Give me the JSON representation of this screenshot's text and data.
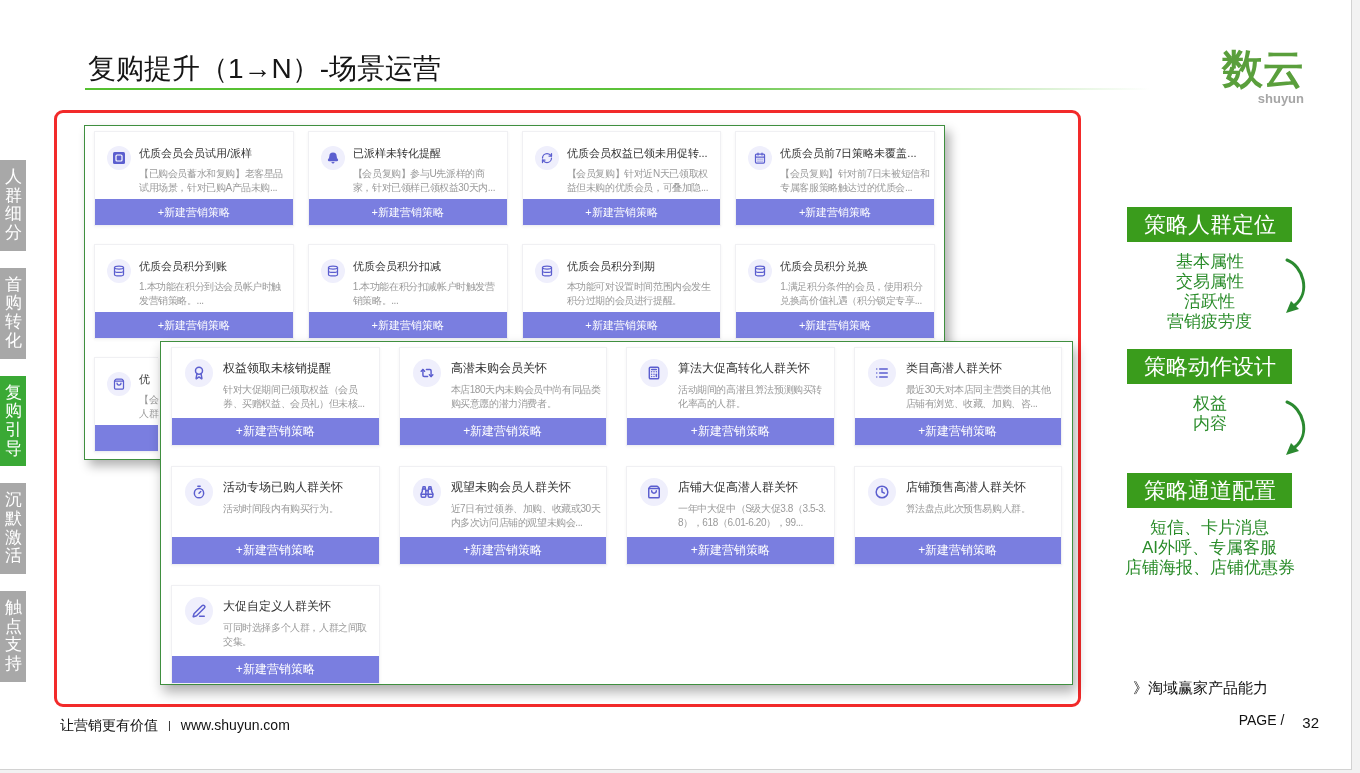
{
  "slide": {
    "title": "复购提升（1→N）-场景运营",
    "logo_mark": "数云",
    "logo_wordmark": "shuyun"
  },
  "side_sections": [
    {
      "label": "人群细分",
      "selected": false
    },
    {
      "label": "首购转化",
      "selected": false
    },
    {
      "label": "复购引导",
      "selected": true
    },
    {
      "label": "沉默激活",
      "selected": false
    },
    {
      "label": "触点支持",
      "selected": false
    }
  ],
  "back_panel": {
    "cards": [
      {
        "kind": "full",
        "title": "优质会员会员试用/派样",
        "description": "【已购会员蓄水和复购】老客星品试用场景，针对已购A产品未购...",
        "action": "+新建营销策略"
      },
      {
        "kind": "full",
        "title": "已派样未转化提醒",
        "description": "【会员复购】参与U先派样的商家，针对已领样已领权益30天内...",
        "action": "+新建营销策略"
      },
      {
        "kind": "full",
        "title": "优质会员权益已领未用促转...",
        "description": "【会员复购】针对近N天已领取权益但未购的优质会员，可叠加隐...",
        "action": "+新建营销策略"
      },
      {
        "kind": "full",
        "title": "优质会员前7日策略未覆盖...",
        "description": "【会员复购】针对前7日未被短信和专属客服策略触达过的优质会...",
        "action": "+新建营销策略"
      },
      {
        "kind": "full",
        "title": "优质会员积分到账",
        "description": "1.本功能在积分到达会员帐户时触发营销策略。...",
        "action": "+新建营销策略"
      },
      {
        "kind": "full",
        "title": "优质会员积分扣减",
        "description": "1.本功能在积分扣减帐户时触发营销策略。...",
        "action": "+新建营销策略"
      },
      {
        "kind": "full",
        "title": "优质会员积分到期",
        "description": "本功能可对设置时间范围内会发生积分过期的会员进行提醒。",
        "action": "+新建营销策略"
      },
      {
        "kind": "full",
        "title": "优质会员积分兑换",
        "description": "1.满足积分条件的会员，使用积分兑换高价值礼遇（积分锁定专享...",
        "action": "+新建营销策略"
      },
      {
        "kind": "covered",
        "title": "优",
        "description": "【会人群"
      }
    ]
  },
  "front_panel": {
    "cards": [
      {
        "title": "权益领取未核销提醒",
        "description": "针对大促期间已领取权益（会员券、买赠权益、会员礼）但未核...",
        "action": "+新建营销策略"
      },
      {
        "title": "高潜未购会员关怀",
        "description": "本店180天内未购会员中尚有同品类购买意愿的潜力消费者。",
        "action": "+新建营销策略"
      },
      {
        "title": "算法大促高转化人群关怀",
        "description": "活动期间的高潜且算法预测购买转化率高的人群。",
        "action": "+新建营销策略"
      },
      {
        "title": "类目高潜人群关怀",
        "description": "最近30天对本店同主营类目的其他店铺有浏览、收藏、加购、咨...",
        "action": "+新建营销策略"
      },
      {
        "title": "活动专场已购人群关怀",
        "description": "活动时间段内有购买行为。",
        "action": "+新建营销策略"
      },
      {
        "title": "观望未购会员人群关怀",
        "description": "近7日有过领券、加购、收藏或30天内多次访问店铺的观望未购会...",
        "action": "+新建营销策略"
      },
      {
        "title": "店铺大促高潜人群关怀",
        "description": "一年中大促中（S级大促3.8（3.5-3.8），618（6.01-6.20），99...",
        "action": "+新建营销策略"
      },
      {
        "title": "店铺预售高潜人群关怀",
        "description": "算法盘点此次预售易购人群。",
        "action": "+新建营销策略"
      },
      {
        "title": "大促自定义人群关怀",
        "description": "可同时选择多个人群，人群之间取交集。",
        "action": "+新建营销策略"
      }
    ]
  },
  "right_panel": {
    "steps": [
      {
        "heading": "策略人群定位",
        "items": [
          "基本属性",
          "交易属性",
          "活跃性",
          "营销疲劳度"
        ]
      },
      {
        "heading": "策略动作设计",
        "items": [
          "权益",
          "内容"
        ]
      },
      {
        "heading": "策略通道配置",
        "items": [
          "短信、卡片消息",
          "AI外呼、专属客服",
          "店铺海报、店铺优惠券"
        ]
      }
    ],
    "product_line": "》淘域赢家产品能力"
  },
  "footer": {
    "slogan": "让营销更有价值",
    "separator": "|",
    "website": "www.shuyun.com",
    "page_label": "PAGE /",
    "page_number": "32"
  }
}
